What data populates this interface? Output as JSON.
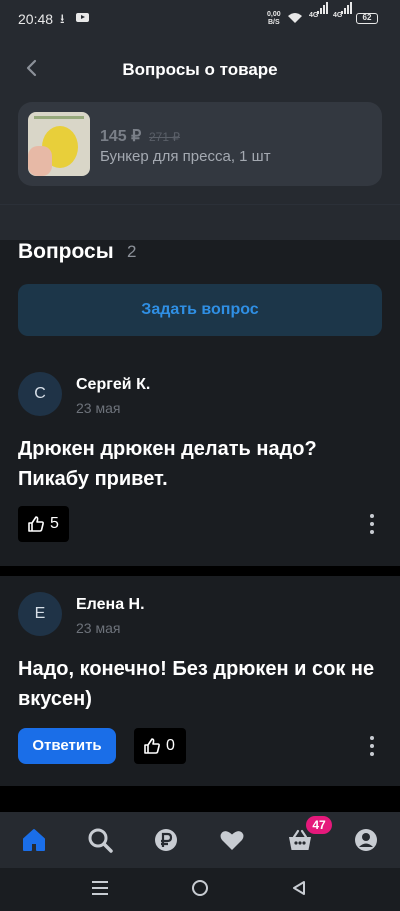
{
  "status_bar": {
    "time": "20:48",
    "net_speed_value": "0,00",
    "net_speed_unit": "B/S",
    "signal_1": "4G",
    "signal_2": "4G",
    "battery": "62"
  },
  "header": {
    "title": "Вопросы о товаре"
  },
  "product": {
    "price": "145 ₽",
    "old_price": "271 ₽",
    "name": "Бункер для пресса, 1 шт"
  },
  "questions_section": {
    "title": "Вопросы",
    "count": "2",
    "ask_button": "Задать вопрос"
  },
  "question": {
    "avatar_letter": "С",
    "author": "Сергей К.",
    "date": "23 мая",
    "text": "Дрюкен дрюкен делать надо? Пикабу привет.",
    "likes": "5"
  },
  "answer": {
    "avatar_letter": "Е",
    "author": "Елена Н.",
    "date": "23 мая",
    "text": "Надо, конечно! Без дрюкен и сок не вкусен)",
    "reply_button": "Ответить",
    "likes": "0"
  },
  "tab_bar": {
    "cart_badge": "47",
    "items": [
      "home-icon",
      "search-icon",
      "ruble-icon",
      "heart-icon",
      "basket-icon",
      "profile-icon"
    ],
    "active_color": "#1a6ee8"
  }
}
